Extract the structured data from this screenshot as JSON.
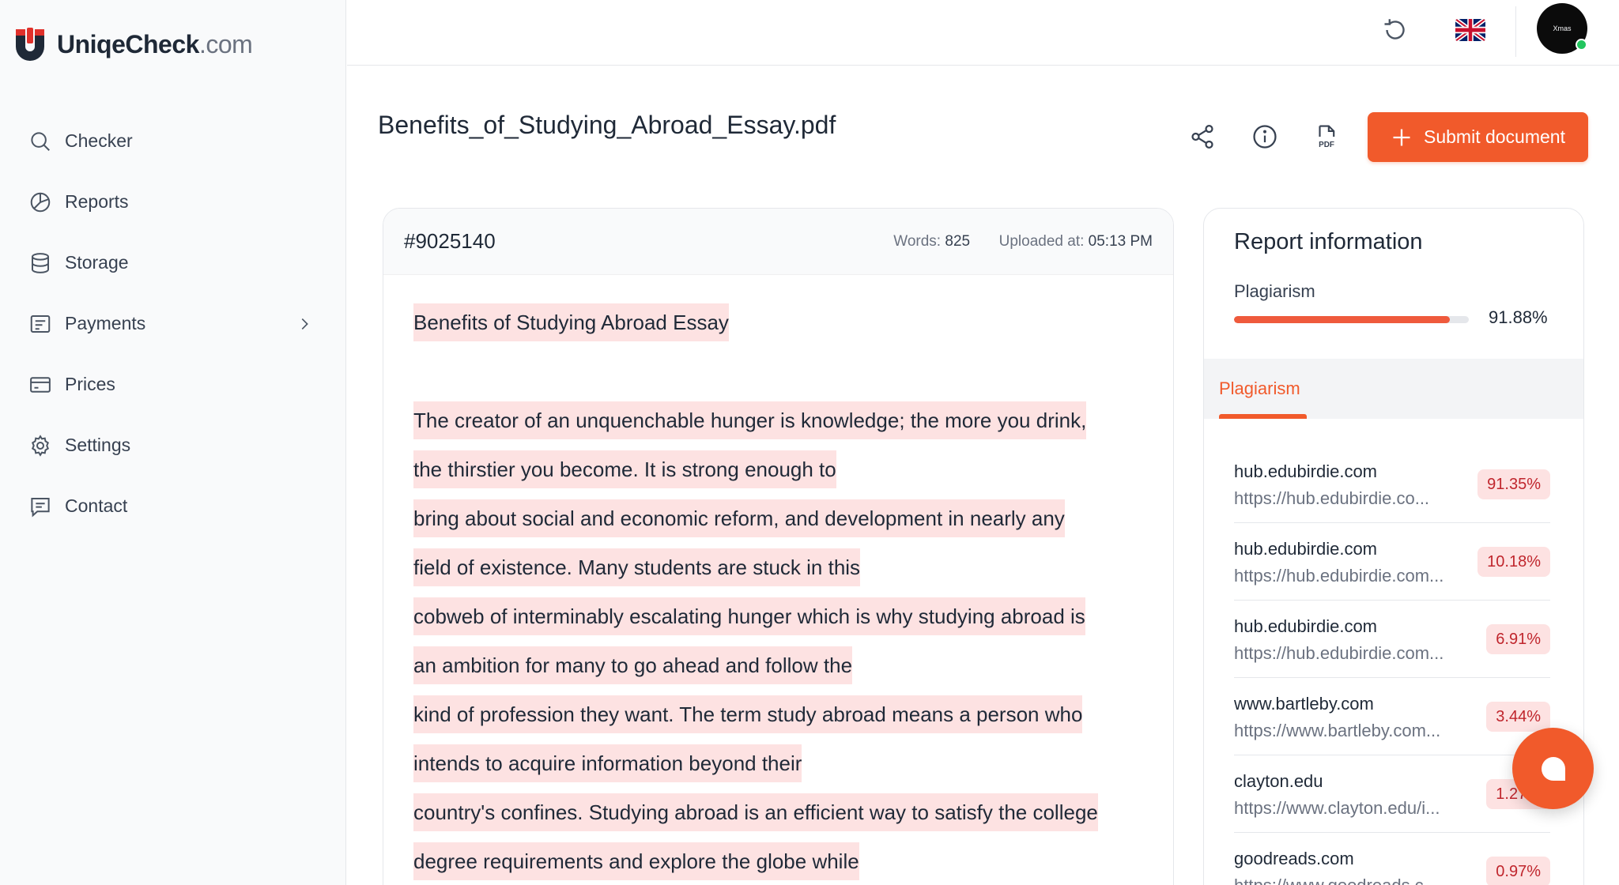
{
  "brand": {
    "name": "UniqeCheck",
    "domain": ".com"
  },
  "sidebar": {
    "items": [
      {
        "label": "Checker",
        "icon": "search-icon"
      },
      {
        "label": "Reports",
        "icon": "pie-chart-icon"
      },
      {
        "label": "Storage",
        "icon": "database-icon"
      },
      {
        "label": "Payments",
        "icon": "receipt-icon"
      },
      {
        "label": "Prices",
        "icon": "card-icon"
      },
      {
        "label": "Settings",
        "icon": "gear-icon"
      },
      {
        "label": "Contact",
        "icon": "message-icon"
      }
    ]
  },
  "header": {
    "avatar_text": "Xmas"
  },
  "document": {
    "file_name": "Benefits_of_Studying_Abroad_Essay.pdf",
    "submit_label": "Submit document",
    "id": "#9025140",
    "words_label": "Words:",
    "words": "825",
    "uploaded_label": "Uploaded at:",
    "uploaded": "05:13 PM",
    "title_line": "Benefits of Studying Abroad Essay",
    "lines": [
      "The creator of an unquenchable hunger is knowledge; the more you drink,",
      "the thirstier you become. It is strong enough to",
      "bring about social and economic reform, and development in nearly any",
      "field of existence. Many students are stuck in this",
      "cobweb of interminably escalating hunger which is why studying abroad is",
      "an ambition for many to go ahead and follow the",
      "kind of profession they want. The term study abroad means a person who",
      "intends to acquire information beyond their",
      "country's confines. Studying abroad is an efficient way to satisfy the college",
      "degree requirements and explore the globe while"
    ]
  },
  "report": {
    "title": "Report information",
    "plagiarism_label": "Plagiarism",
    "plagiarism_pct": "91.88%",
    "plagiarism_fraction": 0.9188,
    "tab_label": "Plagiarism",
    "sources": [
      {
        "name": "hub.edubirdie.com",
        "url": "https://hub.edubirdie.co...",
        "pct": "91.35%"
      },
      {
        "name": "hub.edubirdie.com",
        "url": "https://hub.edubirdie.com...",
        "pct": "10.18%"
      },
      {
        "name": "hub.edubirdie.com",
        "url": "https://hub.edubirdie.com...",
        "pct": "6.91%"
      },
      {
        "name": "www.bartleby.com",
        "url": "https://www.bartleby.com...",
        "pct": "3.44%"
      },
      {
        "name": "clayton.edu",
        "url": "https://www.clayton.edu/i...",
        "pct": "1.27%"
      },
      {
        "name": "goodreads.com",
        "url": "https://www.goodreads.c...",
        "pct": "0.97%"
      }
    ]
  },
  "colors": {
    "accent": "#f15a2b",
    "highlight": "#fde2e2",
    "badge_text": "#c0262d"
  }
}
